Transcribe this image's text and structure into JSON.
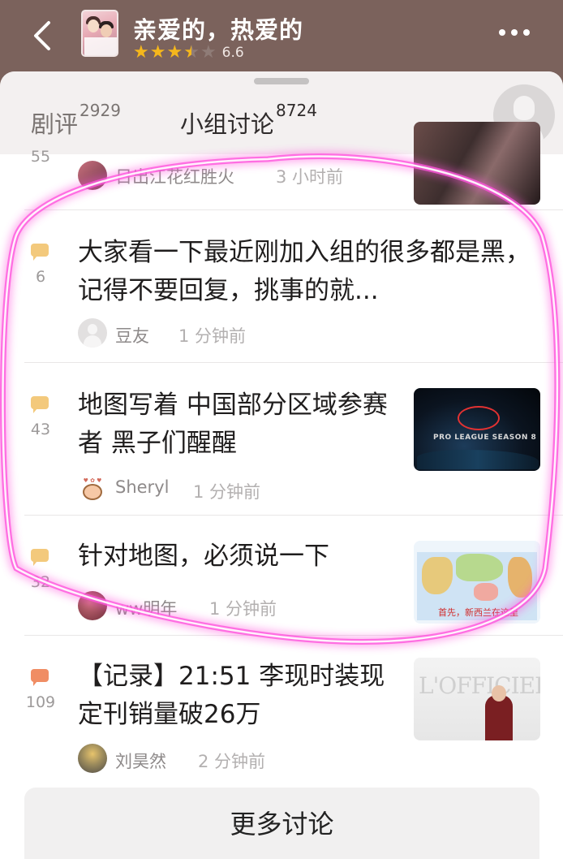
{
  "header": {
    "title": "亲爱的，热爱的",
    "rating": "6.6",
    "stars": 3.5,
    "back_icon": "chevron-left-icon",
    "more_icon": "more-dots-icon"
  },
  "tabs": [
    {
      "label": "剧评",
      "count": "2929"
    },
    {
      "label": "小组讨论",
      "count": "8724"
    }
  ],
  "posts": [
    {
      "title": "",
      "comments": "55",
      "author": "日出江花红胜火",
      "time": "3 小时前"
    },
    {
      "title": "大家看一下最近刚加入组的很多都是黑，记得不要回复，挑事的就...",
      "comments": "6",
      "author": "豆友",
      "time": "1 分钟前"
    },
    {
      "title": "地图写着 中国部分区域参赛者 黑子们醒醒",
      "comments": "43",
      "author": "Sheryl",
      "time": "1 分钟前"
    },
    {
      "title": "针对地图，必须说一下",
      "comments": "32",
      "author": "ww明年",
      "time": "1 分钟前"
    },
    {
      "title": "【记录】21:51 李现时装现定刊销量破26万",
      "comments": "109",
      "author": "刘昊然",
      "time": "2 分钟前"
    }
  ],
  "thumbs": {
    "league_label": "PRO LEAGUE SEASON 8",
    "map_caption": "首先，新西兰在这里",
    "mag_title": "L'OFFICIEL"
  },
  "more_button": "更多讨论",
  "colors": {
    "accent_star": "#f5b71c",
    "annotation": "#ff4fd8"
  }
}
